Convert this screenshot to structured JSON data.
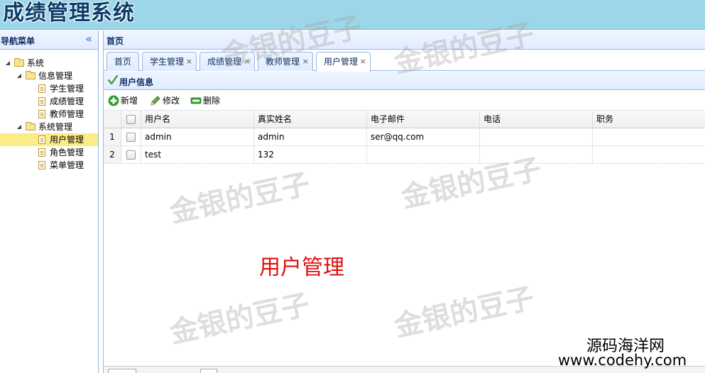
{
  "header": {
    "title": "成绩管理系统"
  },
  "nav": {
    "title": "导航菜单",
    "collapse_glyph": "«",
    "tree": [
      {
        "label": "系统",
        "type": "folder",
        "level": 0,
        "expanded": true
      },
      {
        "label": "信息管理",
        "type": "folder",
        "level": 1,
        "expanded": true
      },
      {
        "label": "学生管理",
        "type": "file",
        "level": 2
      },
      {
        "label": "成绩管理",
        "type": "file",
        "level": 2
      },
      {
        "label": "教师管理",
        "type": "file",
        "level": 2
      },
      {
        "label": "系统管理",
        "type": "folder",
        "level": 1,
        "expanded": true
      },
      {
        "label": "用户管理",
        "type": "file",
        "level": 2,
        "selected": true
      },
      {
        "label": "角色管理",
        "type": "file",
        "level": 2
      },
      {
        "label": "菜单管理",
        "type": "file",
        "level": 2
      }
    ]
  },
  "main": {
    "title": "首页",
    "tabs": [
      {
        "label": "首页",
        "closable": false
      },
      {
        "label": "学生管理",
        "closable": true
      },
      {
        "label": "成绩管理",
        "closable": true
      },
      {
        "label": "教师管理",
        "closable": true
      },
      {
        "label": "用户管理",
        "closable": true,
        "active": true
      }
    ],
    "tab_close_glyph": "×",
    "panel_title": "用户信息",
    "toolbar": {
      "add": "新增",
      "edit": "修改",
      "delete": "删除"
    },
    "grid": {
      "columns": [
        "用户名",
        "真实姓名",
        "电子邮件",
        "电话",
        "职务"
      ],
      "rows": [
        {
          "num": "1",
          "cells": [
            "admin",
            "admin",
            "ser@qq.com",
            "",
            ""
          ]
        },
        {
          "num": "2",
          "cells": [
            "test",
            "132",
            "",
            "",
            ""
          ]
        }
      ]
    }
  },
  "overlay": {
    "watermark": "金银的豆子",
    "caption": "用户管理",
    "credit_line1": "源码海洋网",
    "credit_line2": "www.codehy.com"
  },
  "colors": {
    "accent": "#95b8e7",
    "header_bg": "#9cd6e8",
    "selected_bg": "#fbec88",
    "caption": "#e01010"
  }
}
